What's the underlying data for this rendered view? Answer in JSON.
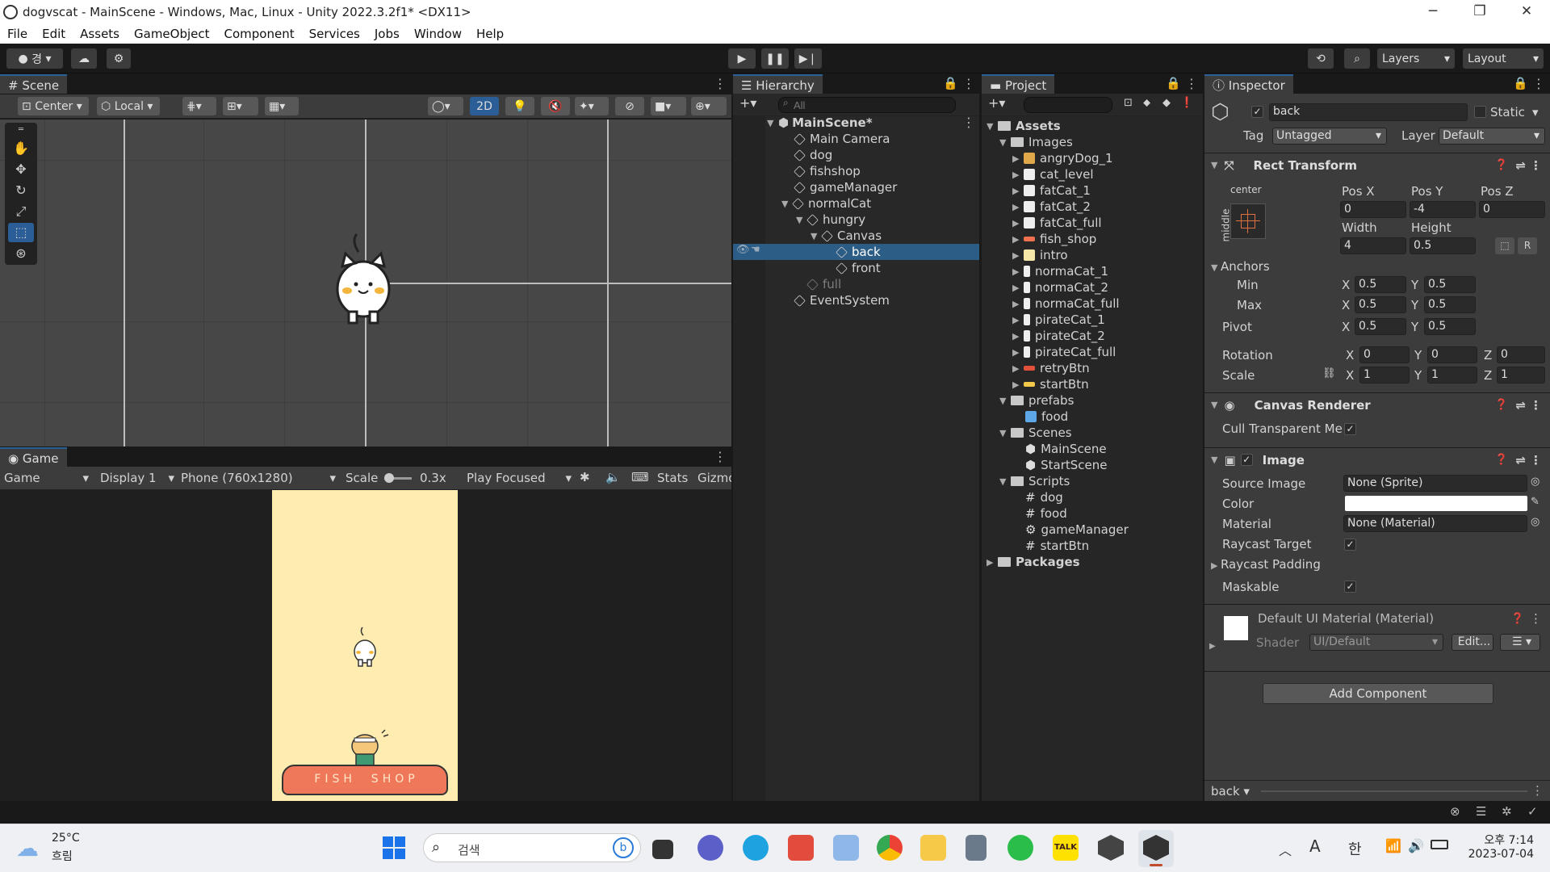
{
  "window": {
    "title": "dogvscat - MainScene - Windows, Mac, Linux - Unity 2022.3.2f1* <DX11>",
    "minimize": "─",
    "restore": "❐",
    "close": "✕"
  },
  "menu": [
    "File",
    "Edit",
    "Assets",
    "GameObject",
    "Component",
    "Services",
    "Jobs",
    "Window",
    "Help"
  ],
  "toolbar": {
    "account": "경",
    "layers": "Layers",
    "layout": "Layout",
    "play": "▶",
    "pause": "❚❚",
    "step": "▶❘"
  },
  "scene": {
    "tab": "Scene",
    "pivot": "Center",
    "space": "Local",
    "mode2d": "2D"
  },
  "game": {
    "tab": "Game",
    "view": "Game",
    "display": "Display 1",
    "resolution": "Phone (760x1280)",
    "scale_label": "Scale",
    "scale_value": "0.3x",
    "play_mode": "Play Focused",
    "stats": "Stats",
    "gizmos": "Gizmos",
    "shop_text": "FISH  SHOP"
  },
  "hierarchy": {
    "tab": "Hierarchy",
    "search_placeholder": "All",
    "scene": "MainScene*",
    "items": [
      {
        "label": "Main Camera",
        "depth": 1
      },
      {
        "label": "dog",
        "depth": 1
      },
      {
        "label": "fishshop",
        "depth": 1
      },
      {
        "label": "gameManager",
        "depth": 1
      },
      {
        "label": "normalCat",
        "depth": 1
      },
      {
        "label": "hungry",
        "depth": 2
      },
      {
        "label": "Canvas",
        "depth": 3
      },
      {
        "label": "back",
        "depth": 4
      },
      {
        "label": "front",
        "depth": 4
      },
      {
        "label": "full",
        "depth": 2
      },
      {
        "label": "EventSystem",
        "depth": 1
      }
    ]
  },
  "project": {
    "tab": "Project",
    "assets": "Assets",
    "images": "Images",
    "image_items": [
      "angryDog_1",
      "cat_level",
      "fatCat_1",
      "fatCat_2",
      "fatCat_full",
      "fish_shop",
      "intro",
      "normaCat_1",
      "normaCat_2",
      "normaCat_full",
      "pirateCat_1",
      "pirateCat_2",
      "pirateCat_full",
      "retryBtn",
      "startBtn"
    ],
    "prefabs": "prefabs",
    "prefab_items": [
      "food"
    ],
    "scenes": "Scenes",
    "scene_items": [
      "MainScene",
      "StartScene"
    ],
    "scripts": "Scripts",
    "script_items": [
      "dog",
      "food",
      "gameManager",
      "startBtn"
    ],
    "packages": "Packages"
  },
  "inspector": {
    "tab": "Inspector",
    "name": "back",
    "static": "Static",
    "tag_label": "Tag",
    "tag": "Untagged",
    "layer_label": "Layer",
    "layer": "Default",
    "rect": {
      "title": "Rect Transform",
      "anchor_h": "center",
      "anchor_v": "middle",
      "posx_label": "Pos X",
      "posy_label": "Pos Y",
      "posz_label": "Pos Z",
      "posx": "0",
      "posy": "-4",
      "posz": "0",
      "width_label": "Width",
      "height_label": "Height",
      "width": "4",
      "height": "0.5",
      "anchors": "Anchors",
      "min": "Min",
      "max": "Max",
      "pivot": "Pivot",
      "rotation": "Rotation",
      "scale": "Scale",
      "x": "X",
      "y": "Y",
      "z": "Z",
      "min_x": "0.5",
      "min_y": "0.5",
      "max_x": "0.5",
      "max_y": "0.5",
      "pivot_x": "0.5",
      "pivot_y": "0.5",
      "rot_x": "0",
      "rot_y": "0",
      "rot_z": "0",
      "scale_x": "1",
      "scale_y": "1",
      "scale_z": "1",
      "raw_btn": "R"
    },
    "canvas_renderer": {
      "title": "Canvas Renderer",
      "cull": "Cull Transparent Me"
    },
    "image": {
      "title": "Image",
      "source_label": "Source Image",
      "source": "None (Sprite)",
      "color_label": "Color",
      "material_label": "Material",
      "material": "None (Material)",
      "raycast_target": "Raycast Target",
      "raycast_padding": "Raycast Padding",
      "maskable": "Maskable"
    },
    "material": {
      "title": "Default UI Material (Material)",
      "shader_label": "Shader",
      "shader": "UI/Default",
      "edit": "Edit..."
    },
    "add_component": "Add Component",
    "footer": "back"
  },
  "taskbar": {
    "temp": "25°C",
    "weather": "흐림",
    "search": "검색",
    "time": "오후 7:14",
    "date": "2023-07-04",
    "lang": "한",
    "ime": "A"
  }
}
